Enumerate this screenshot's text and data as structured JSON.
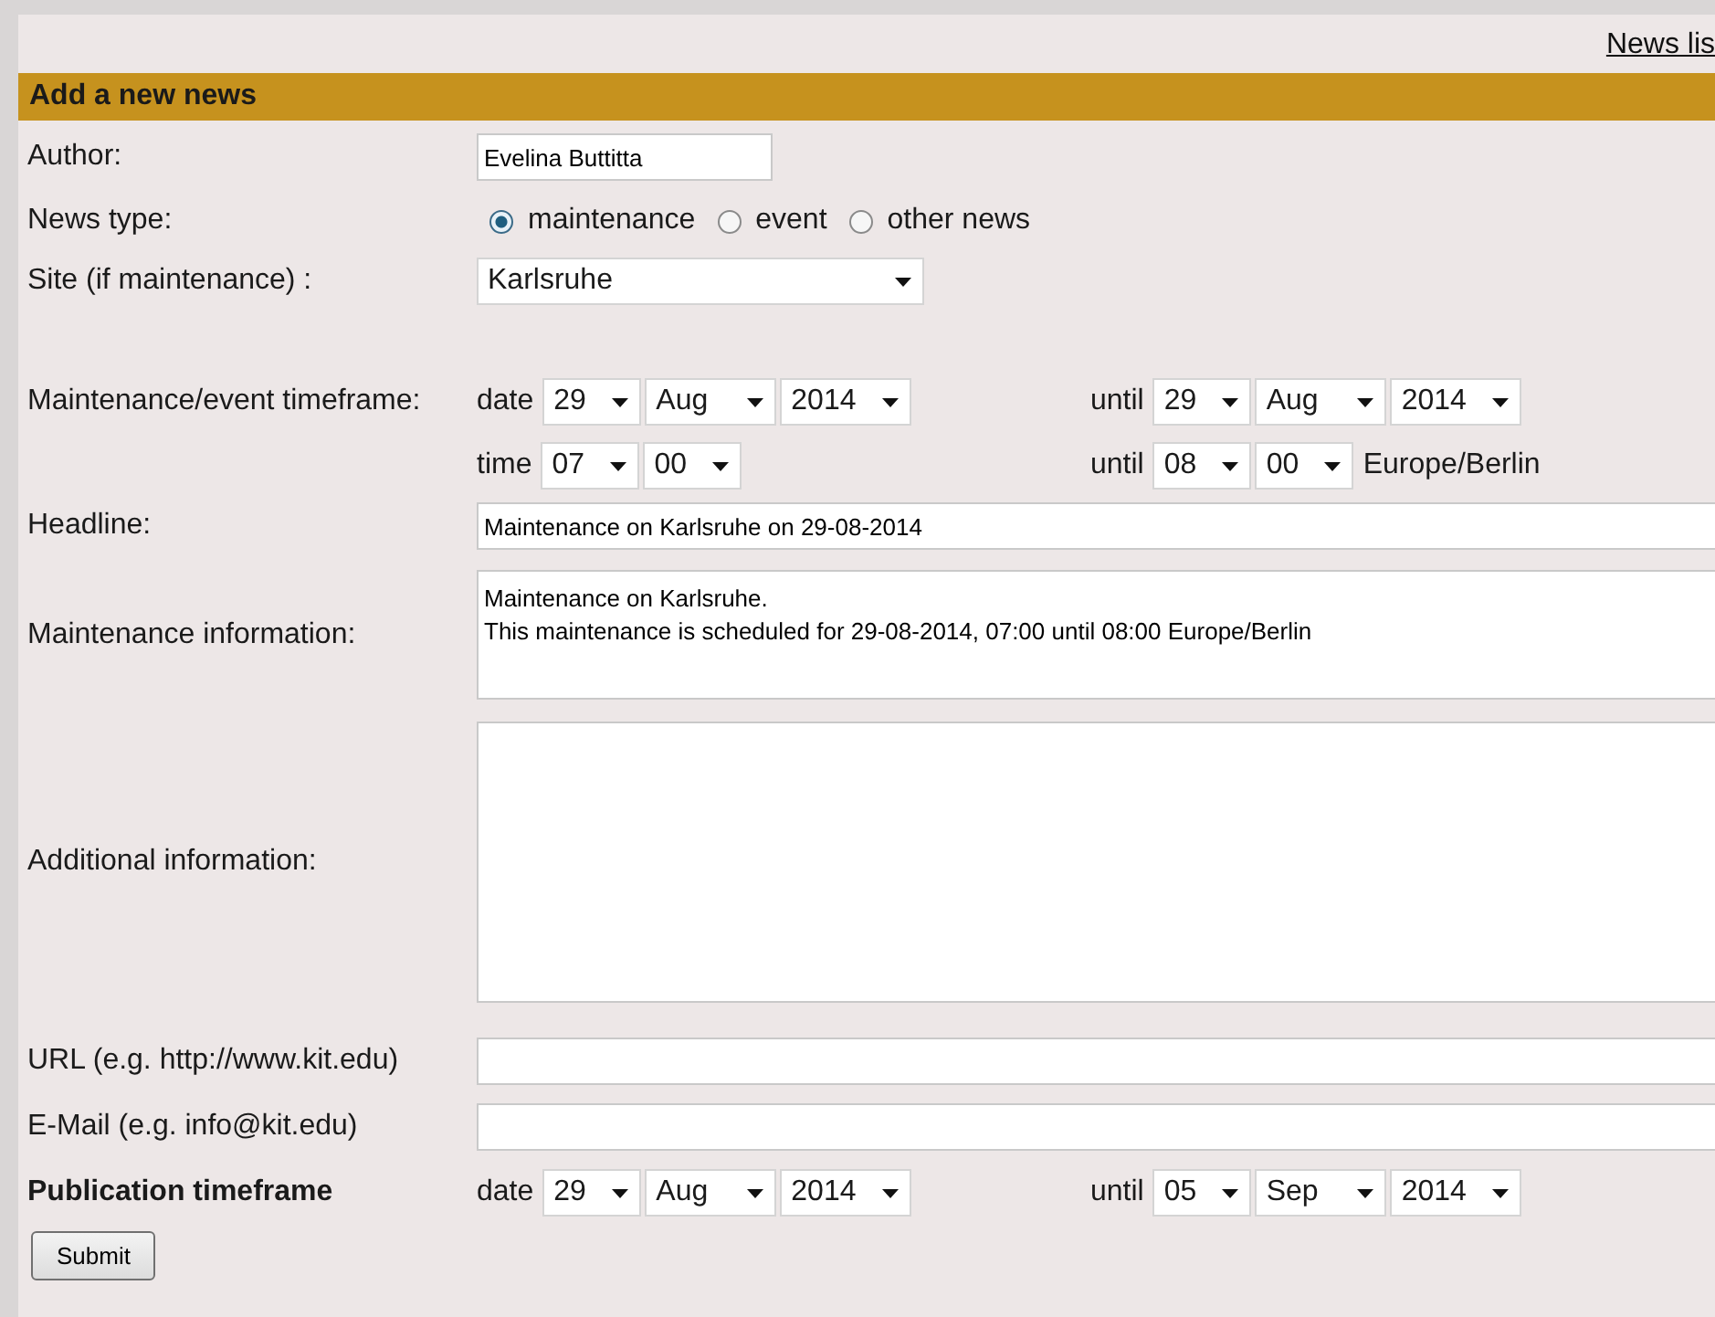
{
  "top_link": "News lis",
  "section_title": "Add a new news",
  "author": {
    "label": "Author:",
    "value": "Evelina Buttitta"
  },
  "news_type": {
    "label": "News type:",
    "options": [
      {
        "label": "maintenance",
        "selected": true
      },
      {
        "label": "event",
        "selected": false
      },
      {
        "label": "other news",
        "selected": false
      }
    ]
  },
  "site": {
    "label": "Site (if maintenance) :",
    "value": "Karlsruhe"
  },
  "timeframe": {
    "label": "Maintenance/event timeframe:",
    "date": {
      "prefix": "date",
      "values": [
        "29",
        "Aug",
        "2014"
      ]
    },
    "date_until": {
      "prefix": "until",
      "values": [
        "29",
        "Aug",
        "2014"
      ]
    },
    "time": {
      "prefix": "time",
      "values": [
        "07",
        "00"
      ]
    },
    "time_until": {
      "prefix": "until",
      "values": [
        "08",
        "00"
      ]
    },
    "timezone": "Europe/Berlin"
  },
  "headline": {
    "label": "Headline:",
    "value": "Maintenance on Karlsruhe on 29-08-2014"
  },
  "maintenance_info": {
    "label": "Maintenance information:",
    "value": "Maintenance on Karlsruhe.\nThis maintenance is scheduled for 29-08-2014, 07:00 until 08:00 Europe/Berlin"
  },
  "additional_info": {
    "label": "Additional information:"
  },
  "url": {
    "label": "URL (e.g. http://www.kit.edu)"
  },
  "email": {
    "label": "E-Mail (e.g. info@kit.edu)"
  },
  "publication": {
    "label": "Publication timeframe",
    "date": {
      "prefix": "date",
      "values": [
        "29",
        "Aug",
        "2014"
      ]
    },
    "date_until": {
      "prefix": "until",
      "values": [
        "05",
        "Sep",
        "2014"
      ]
    }
  },
  "submit": "Submit"
}
